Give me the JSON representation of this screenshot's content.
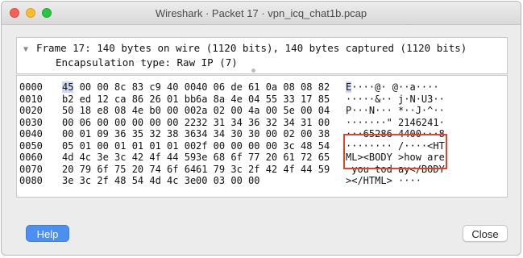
{
  "window": {
    "title": "Wireshark · Packet 17 · vpn_icq_chat1b.pcap"
  },
  "tree": {
    "expand_icon": "triangle-down-icon",
    "frame_label": "Frame 17: 140 bytes on wire (1120 bits), 140 bytes captured (1120 bits)",
    "encapsulation_label": "Encapsulation type: Raw IP (7)"
  },
  "hex_dump": {
    "rows": [
      {
        "offset": "0000",
        "bytes1": "45 00 00 8c 83 c9 40 00",
        "bytes2": "40 06 de 61 0a 08 08 82",
        "ascii": "E····@· @··a····"
      },
      {
        "offset": "0010",
        "bytes1": "b2 ed 12 ca 86 26 01 bb",
        "bytes2": "6a 8a 4e 04 55 33 17 85",
        "ascii": "·····&·· j·N·U3··"
      },
      {
        "offset": "0020",
        "bytes1": "50 18 e8 08 4e b0 00 00",
        "bytes2": "2a 02 00 4a 00 5e 00 04",
        "ascii": "P···N··· *··J·^··"
      },
      {
        "offset": "0030",
        "bytes1": "00 06 00 00 00 00 00 22",
        "bytes2": "32 31 34 36 32 34 31 00",
        "ascii": "·······\" 2146241·"
      },
      {
        "offset": "0040",
        "bytes1": "00 01 09 36 35 32 38 36",
        "bytes2": "34 34 30 30 00 02 00 38",
        "ascii": "···65286 4400···8"
      },
      {
        "offset": "0050",
        "bytes1": "05 01 00 01 01 01 01 00",
        "bytes2": "2f 00 00 00 00 3c 48 54",
        "ascii": "········ /····<HT"
      },
      {
        "offset": "0060",
        "bytes1": "4d 4c 3e 3c 42 4f 44 59",
        "bytes2": "3e 68 6f 77 20 61 72 65",
        "ascii": "ML><BODY >how are"
      },
      {
        "offset": "0070",
        "bytes1": "20 79 6f 75 20 74 6f 64",
        "bytes2": "61 79 3c 2f 42 4f 44 59",
        "ascii": " you tod ay</BODY"
      },
      {
        "offset": "0080",
        "bytes1": "3e 3c 2f 48 54 4d 4c 3e",
        "bytes2": "00 03 00 00",
        "ascii": "></HTML> ····"
      }
    ]
  },
  "buttons": {
    "help_label": "Help",
    "close_label": "Close"
  },
  "colors": {
    "help_button": "#4b8ff0",
    "annotation_box": "#e0432e",
    "selection": "#cfd9f6"
  }
}
